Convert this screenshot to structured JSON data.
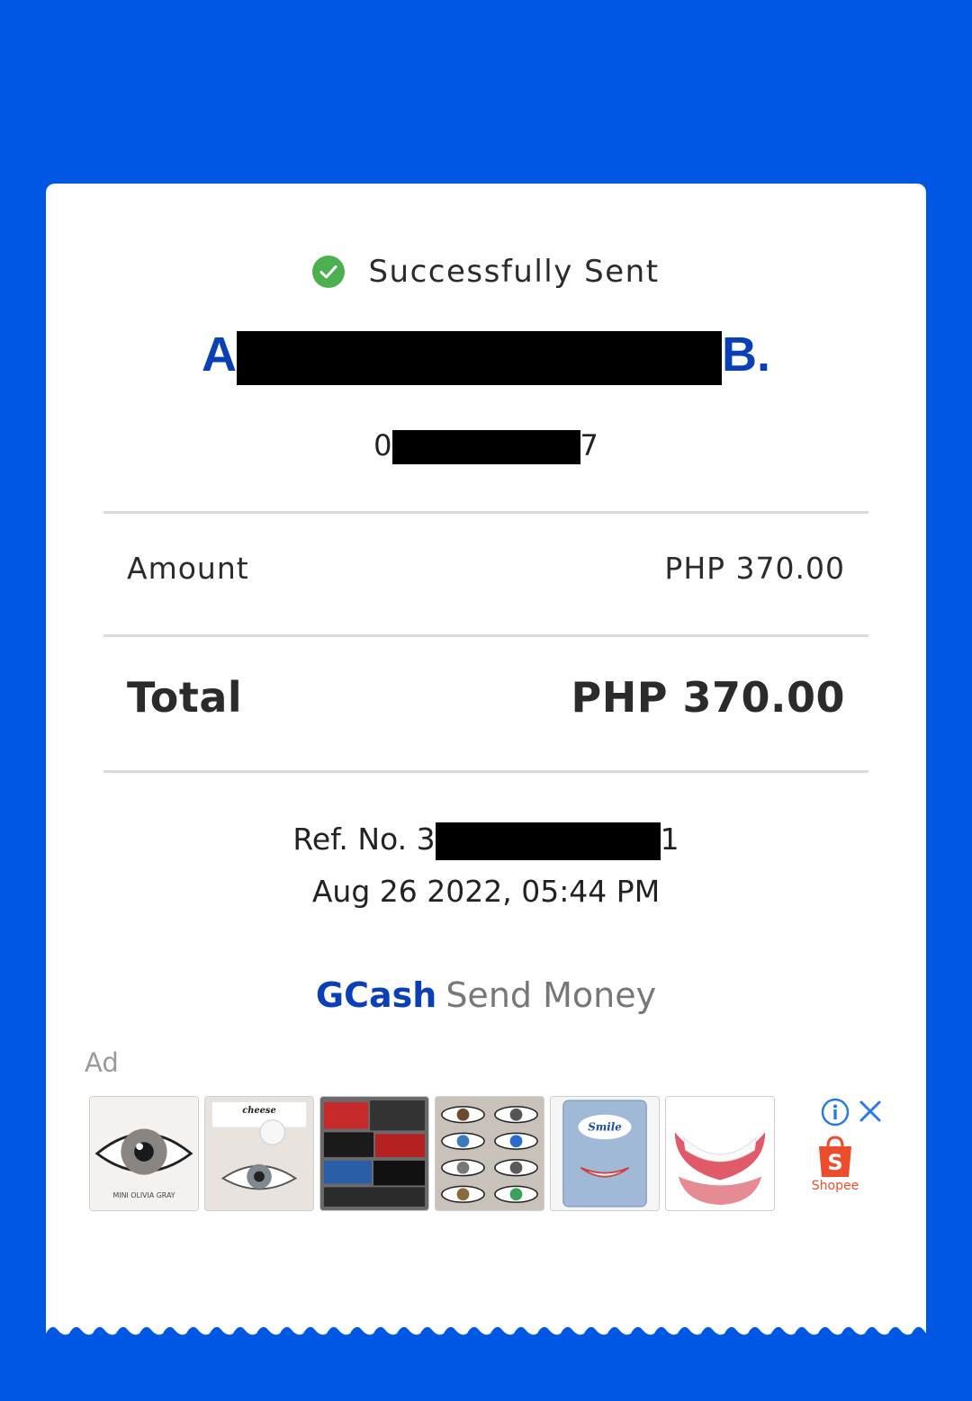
{
  "receipt": {
    "status_text": "Successfully Sent",
    "recipient_prefix": "A",
    "recipient_suffix": "B.",
    "phone_prefix": "0",
    "phone_suffix": "7",
    "amount_label": "Amount",
    "amount_value": "PHP 370.00",
    "total_label": "Total",
    "total_value": "PHP 370.00",
    "ref_prefix": "Ref. No. 3",
    "ref_suffix": "1",
    "date": "Aug 26 2022, 05:44 PM",
    "brand_name": "GCash",
    "service_name": "Send Money"
  },
  "ad": {
    "label": "Ad",
    "advertiser": "Shopee",
    "thumbnails": [
      {
        "name": "contact-lens-gray",
        "caption": "MINI OLIVIA GRAY"
      },
      {
        "name": "contact-lens-cheese",
        "caption": "cheese"
      },
      {
        "name": "bags-assortment",
        "caption": ""
      },
      {
        "name": "colored-lenses-grid",
        "caption": ""
      },
      {
        "name": "smile-veneer-box",
        "caption": "Smile"
      },
      {
        "name": "denture-veneer",
        "caption": ""
      }
    ]
  },
  "colors": {
    "background": "#0057e4",
    "brand_blue": "#0a3fb5",
    "success_green": "#4caf50",
    "shopee_orange": "#ee4d2d"
  },
  "icons": [
    "check-circle-icon",
    "info-icon",
    "close-icon",
    "shopee-bag-icon"
  ]
}
